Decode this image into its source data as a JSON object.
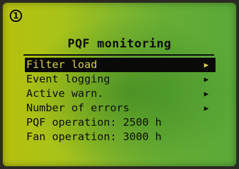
{
  "marker": "1",
  "title": "PQF monitoring",
  "menu": {
    "items": [
      {
        "label": "Filter load",
        "arrow": "▶"
      },
      {
        "label": "Event logging",
        "arrow": "▶"
      },
      {
        "label": "Active warn.",
        "arrow": "▶"
      },
      {
        "label": "Number of errors",
        "arrow": "▶"
      }
    ],
    "info": [
      {
        "text": "PQF operation: 2500 h"
      },
      {
        "text": "Fan operation: 3000 h"
      }
    ]
  },
  "colors": {
    "selected_background": "#0a0a08",
    "selected_text": "#d8d04a"
  }
}
